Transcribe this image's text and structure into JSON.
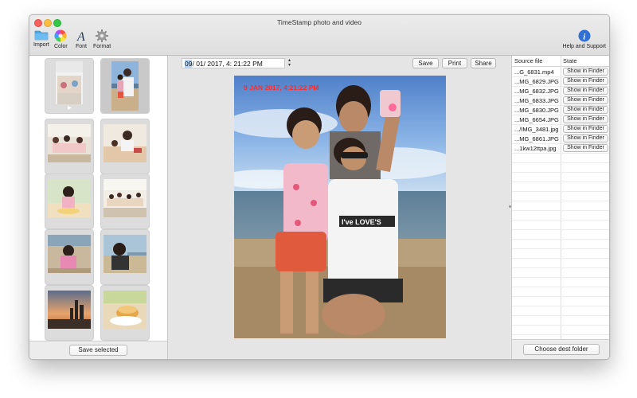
{
  "window": {
    "title": "TimeStamp photo and video"
  },
  "toolbar": {
    "import_label": "Import",
    "color_label": "Color",
    "font_label": "Font",
    "format_label": "Format",
    "help_label": "Help and Support"
  },
  "left_panel": {
    "save_selected_label": "Save selected"
  },
  "editor": {
    "date_month": "09",
    "date_rest": "/ 01/ 2017,  4: 21:22 PM",
    "save_label": "Save",
    "print_label": "Print",
    "share_label": "Share",
    "stamp_text": "9 JAN 2017, 4:21:22 PM",
    "stamp_color": "#ff2a2a"
  },
  "file_table": {
    "headers": {
      "source": "Source file",
      "state": "State"
    },
    "rows": [
      {
        "source": "...G_6831.mp4",
        "action": "Show in Finder"
      },
      {
        "source": "...MG_6829.JPG",
        "action": "Show in Finder"
      },
      {
        "source": "...MG_6832.JPG",
        "action": "Show in Finder"
      },
      {
        "source": "...MG_6833.JPG",
        "action": "Show in Finder"
      },
      {
        "source": "...MG_6830.JPG",
        "action": "Show in Finder"
      },
      {
        "source": "...MG_6654.JPG",
        "action": "Show in Finder"
      },
      {
        "source": ".../IMG_3481.jpg",
        "action": "Show in Finder"
      },
      {
        "source": "...MG_6861.JPG",
        "action": "Show in Finder"
      },
      {
        "source": "...1kw12ttpa.jpg",
        "action": "Show in Finder"
      }
    ],
    "choose_dest_label": "Choose dest folder"
  }
}
